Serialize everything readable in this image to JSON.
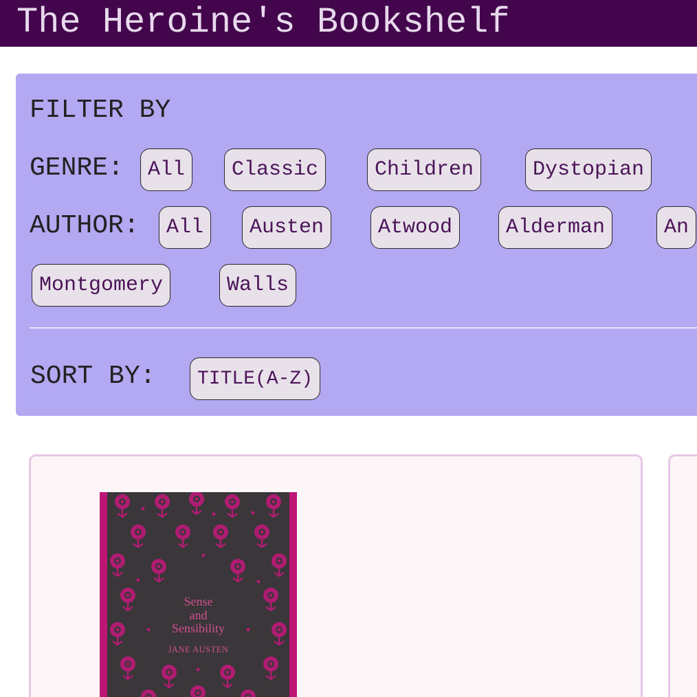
{
  "app": {
    "title": "The Heroine's Bookshelf"
  },
  "filter": {
    "heading": "FILTER BY",
    "genre": {
      "label": "GENRE:",
      "options": [
        "All",
        "Classic",
        "Children",
        "Dystopian"
      ]
    },
    "author": {
      "label": "AUTHOR:",
      "options": [
        "All",
        "Austen",
        "Atwood",
        "Alderman",
        "An",
        "Montgomery",
        "Walls"
      ]
    }
  },
  "sort": {
    "label": "SORT BY:",
    "value": "TITLE(A-Z)"
  },
  "books": [
    {
      "cover_title": [
        "Sense",
        "and",
        "Sensibility"
      ],
      "cover_author": "JANE AUSTEN"
    }
  ],
  "colors": {
    "header_bg": "#43064c",
    "panel_bg": "#b3a8f2",
    "chip_bg": "#e8e1ea",
    "card_border": "#e6c8e8",
    "cover_accent": "#bd1677"
  }
}
